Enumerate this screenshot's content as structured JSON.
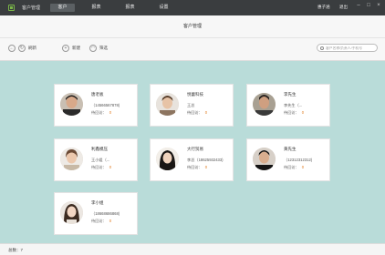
{
  "topbar": {
    "brand": "客户管理",
    "nav": [
      {
        "label": "客户",
        "active": true
      },
      {
        "label": "报表",
        "active": false
      },
      {
        "label": "报表",
        "active": false
      },
      {
        "label": "设置",
        "active": false
      }
    ],
    "user": "惠子涵",
    "logout": "退出"
  },
  "subheader": {
    "title": "客户管理",
    "refresh_label": "刷新",
    "add_label": "新建",
    "filter_label": "筛选",
    "search_placeholder": "客户名称/负责人/手机号"
  },
  "cards": [
    {
      "name": "唐老板",
      "line2": "（14566567878)",
      "pending_label": "待回访：",
      "pending": "0",
      "avatar": "man-dark"
    },
    {
      "name": "悦蕾科技",
      "line2": "王总",
      "pending_label": "待回访：",
      "pending": "0",
      "avatar": "man-young"
    },
    {
      "name": "李先生",
      "line2": "李先生（...",
      "pending_label": "待回访：",
      "pending": "0",
      "avatar": "man-serious"
    },
    {
      "name": "利鑫模压",
      "line2": "王小姐（...",
      "pending_label": "待回访：",
      "pending": "0",
      "avatar": "woman-young"
    },
    {
      "name": "大行贸易",
      "line2": "李总（18625932433)",
      "pending_label": "待回访：",
      "pending": "0",
      "avatar": "woman-long-hair"
    },
    {
      "name": "黄先生",
      "line2": "（12312312312)",
      "pending_label": "待回访：",
      "pending": "0",
      "avatar": "man-short-hair"
    },
    {
      "name": "李小姐",
      "line2": "（18668686868)",
      "pending_label": "待回访：",
      "pending": "0",
      "avatar": "woman-smile"
    }
  ],
  "footer": {
    "total": "总数：7"
  },
  "colors": {
    "topbar": "#3a3d3f",
    "background": "#b9dcd9",
    "pending": "#e07c1f"
  }
}
